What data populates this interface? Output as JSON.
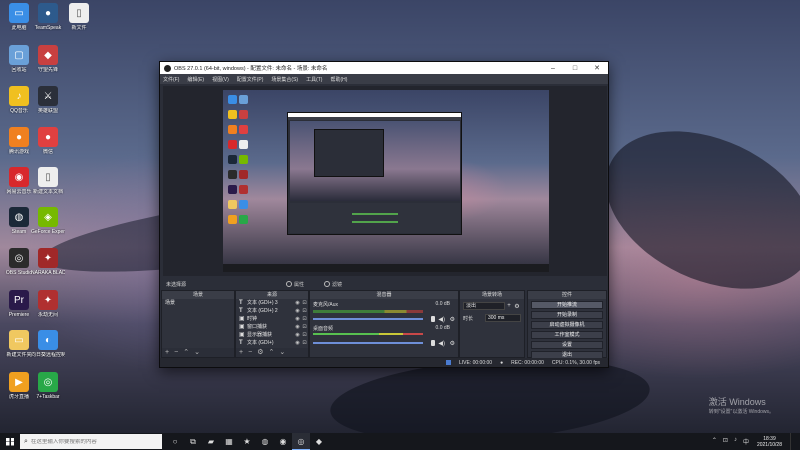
{
  "desktop": {
    "icons": [
      {
        "label": "此电脑",
        "color": "#3a8ee6",
        "glyph": "▭"
      },
      {
        "label": "TeamSpeak",
        "color": "#2d5a8c",
        "glyph": "●"
      },
      {
        "label": "新文件",
        "color": "#eeeeee",
        "glyph": "▯"
      },
      {
        "label": "回收站",
        "color": "#6aa0d8",
        "glyph": "▢"
      },
      {
        "label": "守望先锋",
        "color": "#c84040",
        "glyph": "◆"
      },
      {
        "label": "QQ音乐",
        "color": "#f0c020",
        "glyph": "♪"
      },
      {
        "label": "英雄联盟",
        "color": "#2b2f3a",
        "glyph": "⚔"
      },
      {
        "label": "腾讯游戏",
        "color": "#f08020",
        "glyph": "●"
      },
      {
        "label": "微信",
        "color": "#e04040",
        "glyph": "●"
      },
      {
        "label": "网易云音乐",
        "color": "#d8282c",
        "glyph": "◉"
      },
      {
        "label": "新建文本文档",
        "color": "#eeeeee",
        "glyph": "▯"
      },
      {
        "label": "Steam",
        "color": "#1b2838",
        "glyph": "◍"
      },
      {
        "label": "GeForce Experience",
        "color": "#76b900",
        "glyph": "◈"
      },
      {
        "label": "OBS Studio",
        "color": "#2b2b2b",
        "glyph": "◎"
      },
      {
        "label": "NARAKA BLADEPOINT",
        "color": "#a02828",
        "glyph": "✦"
      },
      {
        "label": "Premiere",
        "color": "#2a1a4a",
        "glyph": "Pr"
      },
      {
        "label": "永劫无间",
        "color": "#b03030",
        "glyph": "✦"
      },
      {
        "label": "新建文件夹",
        "color": "#f0c860",
        "glyph": "▭"
      },
      {
        "label": "向日葵远程控制",
        "color": "#3a8ee6",
        "glyph": "◐"
      },
      {
        "label": "虎牙直播",
        "color": "#f0a020",
        "glyph": "▶"
      },
      {
        "label": "7+Taskbar",
        "color": "#28a848",
        "glyph": "◎"
      }
    ]
  },
  "obs": {
    "title": "OBS 27.0.1 (64-bit, windows) - 配置文件: 未命名 - 场景: 未命名",
    "menu": [
      "文件(F)",
      "编辑(E)",
      "视图(V)",
      "配置文件(P)",
      "场景集合(S)",
      "工具(T)",
      "帮助(H)"
    ],
    "docks_header": {
      "scene_label": "未选择源",
      "properties": "属性",
      "filters": "滤镜"
    },
    "scenes": {
      "title": "场景",
      "items": [
        "场景"
      ]
    },
    "sources": {
      "title": "来源",
      "items": [
        {
          "type": "T",
          "name": "文本 (GDI+) 3"
        },
        {
          "type": "T",
          "name": "文本 (GDI+) 2"
        },
        {
          "type": "▣",
          "name": "时钟"
        },
        {
          "type": "▣",
          "name": "窗口捕获"
        },
        {
          "type": "▣",
          "name": "显示器捕获"
        },
        {
          "type": "T",
          "name": "文本 (GDI+)"
        }
      ]
    },
    "mixer": {
      "title": "混音器",
      "tracks": [
        {
          "name": "麦克风/Aux",
          "db": "0.0 dB"
        },
        {
          "name": "桌面音频",
          "db": "0.0 dB"
        }
      ]
    },
    "transitions": {
      "title": "场景转场",
      "type": "淡出",
      "duration_label": "时长",
      "duration": "300 ms"
    },
    "controls": {
      "title": "控件",
      "buttons": [
        "开始推流",
        "开始录制",
        "启动虚拟摄像机",
        "工作室模式",
        "设置",
        "退出"
      ]
    },
    "status": {
      "live": "LIVE: 00:00:00",
      "rec": "REC: 00:00:00",
      "cpu": "CPU: 0.1%, 30.00 fps"
    }
  },
  "watermark": {
    "line1": "激活 Windows",
    "line2": "转到\"设置\"以激活 Windows。"
  },
  "taskbar": {
    "search_placeholder": "在这里输入你要搜索的内容",
    "apps": [
      "○",
      "⧉",
      "▰",
      "▦",
      "★",
      "◍",
      "◉",
      "◎",
      "◆"
    ],
    "clock_time": "18:39",
    "clock_date": "2021/10/28",
    "tray_icons": [
      "⌃",
      "⊡",
      "♪",
      "中"
    ]
  }
}
